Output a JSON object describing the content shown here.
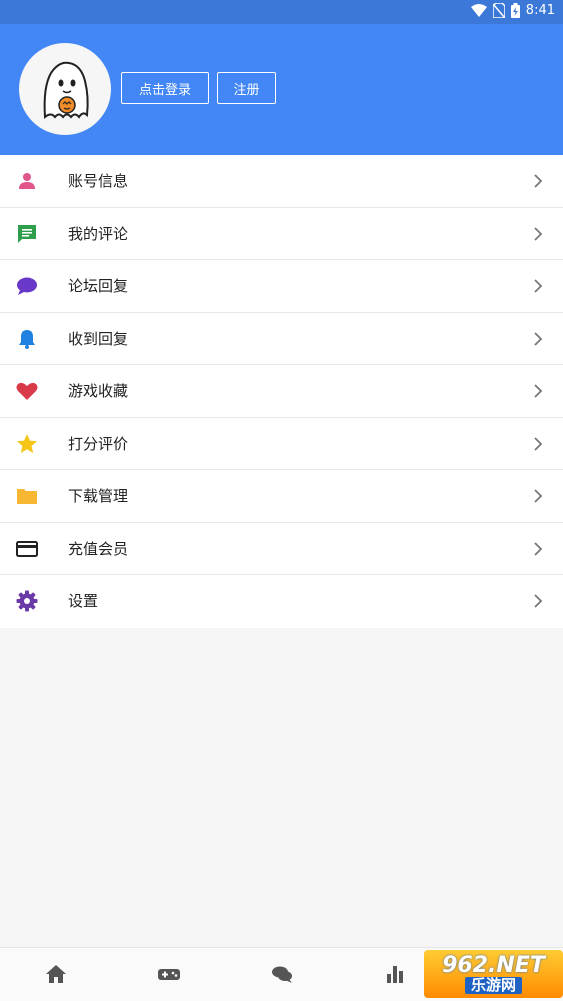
{
  "status_bar": {
    "time": "8:41"
  },
  "header": {
    "login_label": "点击登录",
    "register_label": "注册"
  },
  "menu": {
    "items": [
      {
        "label": "账号信息",
        "icon": "person-icon",
        "color": "#e0558a"
      },
      {
        "label": "我的评论",
        "icon": "comment-icon",
        "color": "#2e9e4a"
      },
      {
        "label": "论坛回复",
        "icon": "chat-bubble-icon",
        "color": "#6a38c8"
      },
      {
        "label": "收到回复",
        "icon": "bell-icon",
        "color": "#1f80e0"
      },
      {
        "label": "游戏收藏",
        "icon": "heart-icon",
        "color": "#d93a4a"
      },
      {
        "label": "打分评价",
        "icon": "star-icon",
        "color": "#f5c518"
      },
      {
        "label": "下载管理",
        "icon": "folder-icon",
        "color": "#f7b733"
      },
      {
        "label": "充值会员",
        "icon": "credit-card-icon",
        "color": "#222222"
      },
      {
        "label": "设置",
        "icon": "gear-icon",
        "color": "#6a3aa8"
      }
    ]
  },
  "bottom_nav": {
    "tabs": [
      {
        "icon": "home-icon"
      },
      {
        "icon": "gamepad-icon"
      },
      {
        "icon": "chat-icon"
      },
      {
        "icon": "bar-chart-icon"
      }
    ]
  },
  "watermark": {
    "top": "962.NET",
    "bottom": "乐游网"
  }
}
